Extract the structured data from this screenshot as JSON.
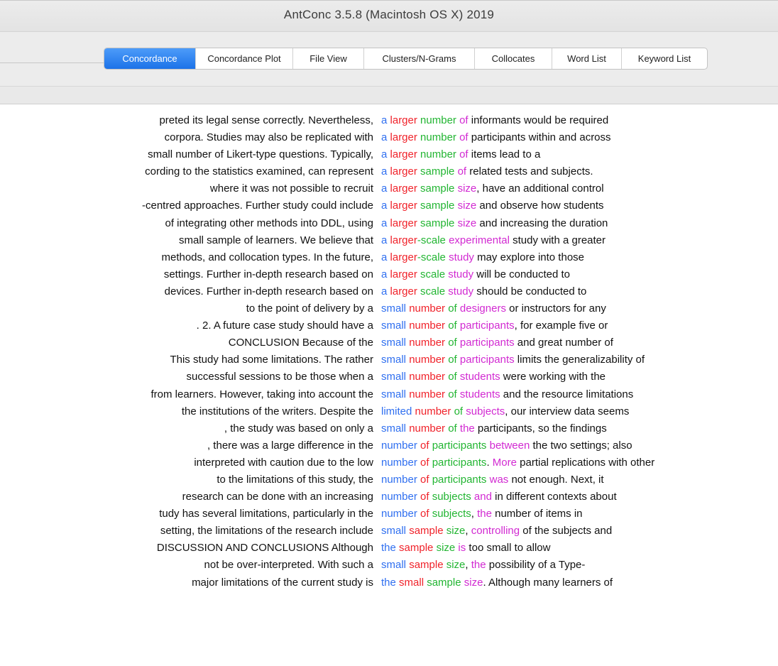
{
  "window": {
    "title": "AntConc 3.5.8 (Macintosh OS X) 2019"
  },
  "tabs": [
    {
      "label": "Concordance",
      "active": true
    },
    {
      "label": "Concordance Plot",
      "active": false
    },
    {
      "label": "File View",
      "active": false
    },
    {
      "label": "Clusters/N-Grams",
      "active": false
    },
    {
      "label": "Collocates",
      "active": false
    },
    {
      "label": "Word List",
      "active": false
    },
    {
      "label": "Keyword List",
      "active": false
    }
  ],
  "colors": {
    "accent_tab": "#1c72e8",
    "hit_blue": "#2f6ff0",
    "hit_red": "#f0222a",
    "hit_green": "#22b532",
    "hit_magenta": "#d22ad2"
  },
  "concordance": {
    "rows": [
      {
        "left": "preted its legal sense correctly.   Nevertheless,",
        "right": [
          [
            "a",
            "blue"
          ],
          [
            " "
          ],
          [
            "larger",
            "red"
          ],
          [
            " "
          ],
          [
            "number",
            "green"
          ],
          [
            " "
          ],
          [
            "of",
            "mag"
          ],
          [
            " informants would be required"
          ]
        ]
      },
      {
        "left": "corpora. Studies may also be replicated with",
        "right": [
          [
            "a",
            "blue"
          ],
          [
            " "
          ],
          [
            "larger",
            "red"
          ],
          [
            " "
          ],
          [
            "number",
            "green"
          ],
          [
            " "
          ],
          [
            "of",
            "mag"
          ],
          [
            " participants within and across"
          ]
        ]
      },
      {
        "left": "small number of Likert-type questions. Typically,",
        "right": [
          [
            "a",
            "blue"
          ],
          [
            " "
          ],
          [
            "larger",
            "red"
          ],
          [
            " "
          ],
          [
            "number",
            "green"
          ],
          [
            " "
          ],
          [
            "of",
            "mag"
          ],
          [
            " items lead to a"
          ]
        ]
      },
      {
        "left": "cording to the statistics examined, can represent",
        "right": [
          [
            "a",
            "blue"
          ],
          [
            " "
          ],
          [
            "larger",
            "red"
          ],
          [
            " "
          ],
          [
            "sample",
            "green"
          ],
          [
            " "
          ],
          [
            "of",
            "mag"
          ],
          [
            " related tests and subjects."
          ]
        ]
      },
      {
        "left": "where it was not possible to recruit",
        "right": [
          [
            "a",
            "blue"
          ],
          [
            " "
          ],
          [
            "larger",
            "red"
          ],
          [
            " "
          ],
          [
            "sample",
            "green"
          ],
          [
            " "
          ],
          [
            "size",
            "mag"
          ],
          [
            ", have an additional control"
          ]
        ]
      },
      {
        "left": "-centred approaches.  Further study could include",
        "right": [
          [
            "a",
            "blue"
          ],
          [
            " "
          ],
          [
            "larger",
            "red"
          ],
          [
            " "
          ],
          [
            "sample",
            "green"
          ],
          [
            " "
          ],
          [
            "size",
            "mag"
          ],
          [
            " and observe how students"
          ]
        ]
      },
      {
        "left": "of integrating other methods into DDL, using",
        "right": [
          [
            "a",
            "blue"
          ],
          [
            " "
          ],
          [
            "larger",
            "red"
          ],
          [
            " "
          ],
          [
            "sample",
            "green"
          ],
          [
            " "
          ],
          [
            "size",
            "mag"
          ],
          [
            " and increasing the duration"
          ]
        ]
      },
      {
        "left": "small sample of learners. We believe that",
        "right": [
          [
            "a",
            "blue"
          ],
          [
            " "
          ],
          [
            "larger",
            "red"
          ],
          [
            "-scale",
            "green"
          ],
          [
            " "
          ],
          [
            "experimental",
            "mag"
          ],
          [
            " study with a greater"
          ]
        ]
      },
      {
        "left": "methods, and collocation types. In the future,",
        "right": [
          [
            "a",
            "blue"
          ],
          [
            " "
          ],
          [
            "larger",
            "red"
          ],
          [
            "-scale",
            "green"
          ],
          [
            " "
          ],
          [
            "study",
            "mag"
          ],
          [
            " may explore into those"
          ]
        ]
      },
      {
        "left": "settings. Further in-depth research based on",
        "right": [
          [
            "a",
            "blue"
          ],
          [
            " "
          ],
          [
            "larger",
            "red"
          ],
          [
            " "
          ],
          [
            "scale",
            "green"
          ],
          [
            " "
          ],
          [
            "study",
            "mag"
          ],
          [
            " will be conducted to"
          ]
        ]
      },
      {
        "left": "devices. Further in-depth research based on",
        "right": [
          [
            "a",
            "blue"
          ],
          [
            " "
          ],
          [
            "larger",
            "red"
          ],
          [
            " "
          ],
          [
            "scale",
            "green"
          ],
          [
            " "
          ],
          [
            "study",
            "mag"
          ],
          [
            " should be conducted to"
          ]
        ]
      },
      {
        "left": "to the point of delivery by a",
        "right": [
          [
            "small",
            "blue"
          ],
          [
            " "
          ],
          [
            "number",
            "red"
          ],
          [
            " "
          ],
          [
            "of",
            "green"
          ],
          [
            " "
          ],
          [
            "designers",
            "mag"
          ],
          [
            " or instructors for any"
          ]
        ]
      },
      {
        "left": ".   2. A future case study should have a",
        "right": [
          [
            "small",
            "blue"
          ],
          [
            " "
          ],
          [
            "number",
            "red"
          ],
          [
            " "
          ],
          [
            "of",
            "green"
          ],
          [
            " "
          ],
          [
            "participants",
            "mag"
          ],
          [
            ", for example five or"
          ]
        ]
      },
      {
        "left": "CONCLUSION  Because of the",
        "right": [
          [
            "small",
            "blue"
          ],
          [
            " "
          ],
          [
            "number",
            "red"
          ],
          [
            " "
          ],
          [
            "of",
            "green"
          ],
          [
            " "
          ],
          [
            "participants",
            "mag"
          ],
          [
            " and great number of"
          ]
        ]
      },
      {
        "left": "This study had some limitations. The rather",
        "right": [
          [
            "small",
            "blue"
          ],
          [
            " "
          ],
          [
            "number",
            "red"
          ],
          [
            " "
          ],
          [
            "of",
            "green"
          ],
          [
            " "
          ],
          [
            "participants",
            "mag"
          ],
          [
            " limits the generalizability of"
          ]
        ]
      },
      {
        "left": "successful sessions to be those when a",
        "right": [
          [
            "small",
            "blue"
          ],
          [
            " "
          ],
          [
            "number",
            "red"
          ],
          [
            " "
          ],
          [
            "of",
            "green"
          ],
          [
            " "
          ],
          [
            "students",
            "mag"
          ],
          [
            " were working with the"
          ]
        ]
      },
      {
        "left": "from learners. However, taking into account the",
        "right": [
          [
            "small",
            "blue"
          ],
          [
            " "
          ],
          [
            "number",
            "red"
          ],
          [
            " "
          ],
          [
            "of",
            "green"
          ],
          [
            " "
          ],
          [
            "students",
            "mag"
          ],
          [
            " and the resource limitations"
          ]
        ]
      },
      {
        "left": "the institutions of the writers.   Despite the",
        "right": [
          [
            "limited",
            "blue"
          ],
          [
            " "
          ],
          [
            "number",
            "red"
          ],
          [
            " "
          ],
          [
            "of",
            "green"
          ],
          [
            " "
          ],
          [
            "subjects",
            "mag"
          ],
          [
            ", our interview data seems"
          ]
        ]
      },
      {
        "left": ", the study was based on only a",
        "right": [
          [
            "small",
            "blue"
          ],
          [
            " "
          ],
          [
            "number",
            "red"
          ],
          [
            " "
          ],
          [
            "of",
            "green"
          ],
          [
            " "
          ],
          [
            "the",
            "mag"
          ],
          [
            " participants, so the findings"
          ]
        ]
      },
      {
        "left": ", there was a large difference in the",
        "right": [
          [
            "number",
            "blue"
          ],
          [
            " "
          ],
          [
            "of",
            "red"
          ],
          [
            " "
          ],
          [
            "participants",
            "green"
          ],
          [
            " "
          ],
          [
            "between",
            "mag"
          ],
          [
            " the two settings; also"
          ]
        ]
      },
      {
        "left": "interpreted with caution due to the low",
        "right": [
          [
            "number",
            "blue"
          ],
          [
            " "
          ],
          [
            "of",
            "red"
          ],
          [
            " "
          ],
          [
            "participants",
            "green"
          ],
          [
            "."
          ],
          [
            " "
          ],
          [
            "More",
            "mag"
          ],
          [
            " partial replications with other"
          ]
        ]
      },
      {
        "left": "to the limitations of this study, the",
        "right": [
          [
            "number",
            "blue"
          ],
          [
            " "
          ],
          [
            "of",
            "red"
          ],
          [
            " "
          ],
          [
            "participants",
            "green"
          ],
          [
            " "
          ],
          [
            "was",
            "mag"
          ],
          [
            " not enough.  Next, it"
          ]
        ]
      },
      {
        "left": "research can be done with an increasing",
        "right": [
          [
            "number",
            "blue"
          ],
          [
            " "
          ],
          [
            "of",
            "red"
          ],
          [
            " "
          ],
          [
            "subjects",
            "green"
          ],
          [
            " "
          ],
          [
            "and",
            "mag"
          ],
          [
            " in different contexts about"
          ]
        ]
      },
      {
        "left": "tudy has several limitations, particularly in the",
        "right": [
          [
            "number",
            "blue"
          ],
          [
            " "
          ],
          [
            "of",
            "red"
          ],
          [
            " "
          ],
          [
            "subjects",
            "green"
          ],
          [
            ", "
          ],
          [
            "the",
            "mag"
          ],
          [
            " number of items in"
          ]
        ]
      },
      {
        "left": "setting, the limitations of the research include",
        "right": [
          [
            "small",
            "blue"
          ],
          [
            " "
          ],
          [
            "sample",
            "red"
          ],
          [
            " "
          ],
          [
            "size",
            "green"
          ],
          [
            ", "
          ],
          [
            "controlling",
            "mag"
          ],
          [
            " of the subjects and"
          ]
        ]
      },
      {
        "left": "DISCUSSION AND CONCLUSIONS   Although",
        "right": [
          [
            "the",
            "blue"
          ],
          [
            " "
          ],
          [
            "sample",
            "red"
          ],
          [
            " "
          ],
          [
            "size",
            "green"
          ],
          [
            " "
          ],
          [
            "is",
            "mag"
          ],
          [
            " too small to allow"
          ]
        ]
      },
      {
        "left": "not be over-interpreted. With such a",
        "right": [
          [
            "small",
            "blue"
          ],
          [
            " "
          ],
          [
            "sample",
            "red"
          ],
          [
            " "
          ],
          [
            "size",
            "green"
          ],
          [
            ", "
          ],
          [
            "the",
            "mag"
          ],
          [
            " possibility of a Type-"
          ]
        ]
      },
      {
        "left": "major limitations of the current study is",
        "right": [
          [
            "the",
            "blue"
          ],
          [
            " "
          ],
          [
            "small",
            "red"
          ],
          [
            " "
          ],
          [
            "sample",
            "green"
          ],
          [
            " "
          ],
          [
            "size",
            "mag"
          ],
          [
            ". Although many learners of"
          ]
        ]
      }
    ]
  }
}
